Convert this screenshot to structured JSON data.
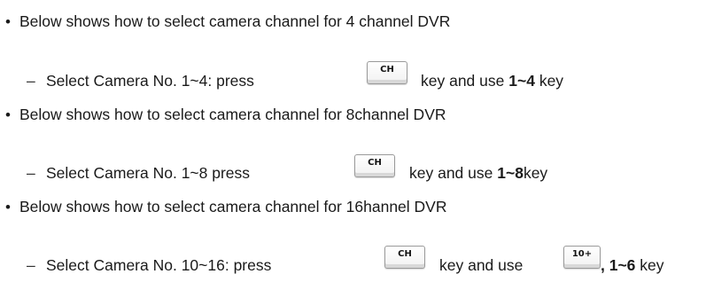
{
  "sections": [
    {
      "bullet": "•",
      "heading": "Below shows how to select camera channel for 4 channel DVR",
      "dash": "–",
      "step_prefix": "Select Camera No. 1~4: press",
      "key_label": "CH",
      "step_mid": "key and use",
      "step_bold": "1~4",
      "step_suffix": "key"
    },
    {
      "bullet": "•",
      "heading": "Below shows how to select camera channel for 8channel DVR",
      "dash": "–",
      "step_prefix": "Select Camera No. 1~8 press",
      "key_label": "CH",
      "step_mid": "key and use",
      "step_bold": "1~8",
      "step_suffix": "key"
    },
    {
      "bullet": "•",
      "heading": "Below shows how to select camera channel for 16hannel DVR",
      "dash": "–",
      "step_prefix": "Select Camera No. 10~16: press",
      "key_label": "CH",
      "step_mid": "key and use",
      "key2_label": "10+",
      "step_bold": ", 1~6",
      "step_suffix": "key"
    }
  ]
}
